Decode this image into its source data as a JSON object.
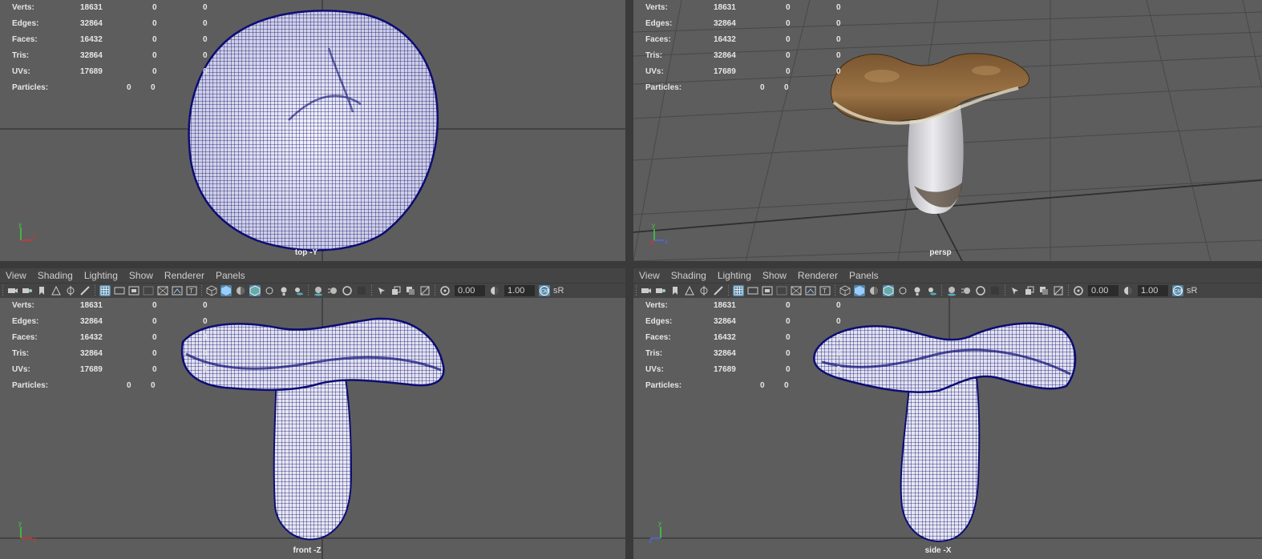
{
  "stats": {
    "rows": [
      {
        "label": "Verts:",
        "v1": "18631",
        "v2": "0",
        "v3": "0"
      },
      {
        "label": "Edges:",
        "v1": "32864",
        "v2": "0",
        "v3": "0"
      },
      {
        "label": "Faces:",
        "v1": "16432",
        "v2": "0",
        "v3": "0"
      },
      {
        "label": "Tris:",
        "v1": "32864",
        "v2": "0",
        "v3": "0"
      },
      {
        "label": "UVs:",
        "v1": "17689",
        "v2": "0",
        "v3": "0"
      }
    ],
    "particles": {
      "label": "Particles:",
      "v1": "0",
      "v2": "0"
    }
  },
  "viewports": {
    "top": {
      "camera": "top -Y"
    },
    "persp": {
      "camera": "persp"
    },
    "front": {
      "camera": "front -Z"
    },
    "side": {
      "camera": "side -X"
    }
  },
  "axis_labels": {
    "y": "y",
    "x": "x",
    "z": "z"
  },
  "menus": [
    "View",
    "Shading",
    "Lighting",
    "Show",
    "Renderer",
    "Panels"
  ],
  "toolbar": {
    "exposure": "0.00",
    "gamma": "1.00",
    "color_space": "sR"
  },
  "colors": {
    "viewport_bg": "#5d5d5d",
    "wireframe": "#0d0d73",
    "accent": "#5285a6",
    "cap_brown": "#8b6238",
    "stem_white": "#d8d8dc"
  }
}
